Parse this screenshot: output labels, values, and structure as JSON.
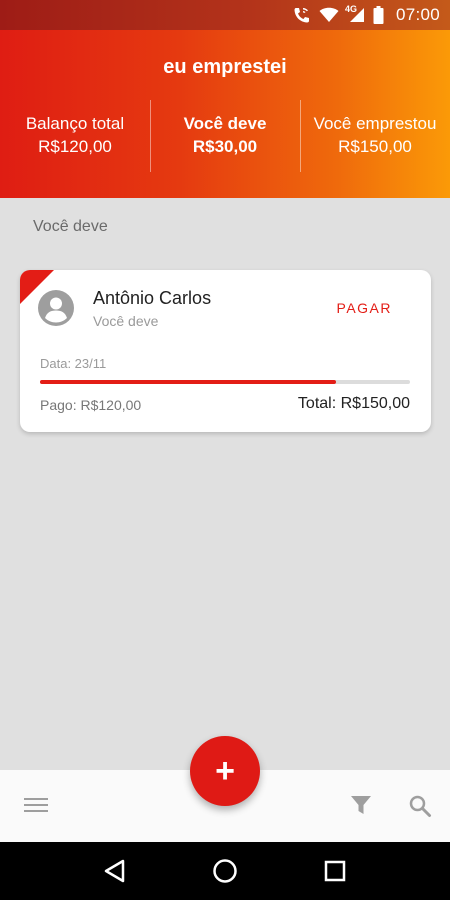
{
  "status_bar": {
    "time": "07:00",
    "network": "4G",
    "icons": [
      "call-wifi-icon",
      "wifi-icon",
      "signal-icon",
      "battery-icon"
    ]
  },
  "header": {
    "title": "eu emprestei",
    "stats": [
      {
        "label": "Balanço total",
        "value": "R$120,00"
      },
      {
        "label": "Você deve",
        "value": "R$30,00"
      },
      {
        "label": "Você emprestou",
        "value": "R$150,00"
      }
    ]
  },
  "section": {
    "title": "Você deve"
  },
  "card": {
    "name": "Antônio Carlos",
    "subtitle": "Você deve",
    "action_label": "PAGAR",
    "date": "Data: 23/11",
    "paid": "Pago: R$120,00",
    "total": "Total: R$150,00",
    "progress_fraction": 0.8
  },
  "fab": {
    "label": "+"
  },
  "colors": {
    "accent": "#e31d16",
    "header_start": "#df1d13",
    "header_end": "#fb9a07"
  }
}
